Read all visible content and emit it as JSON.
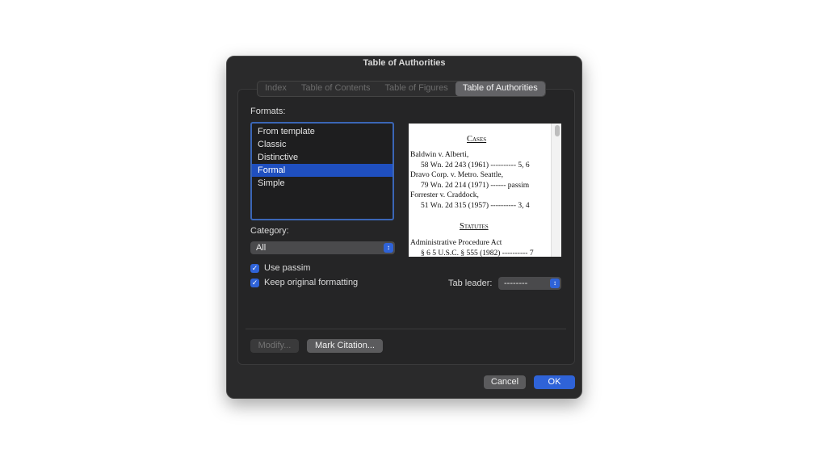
{
  "dialog": {
    "title": "Table of Authorities"
  },
  "tabs": [
    "Index",
    "Table of Contents",
    "Table of Figures",
    "Table of Authorities"
  ],
  "formats": {
    "label": "Formats:",
    "items": [
      "From template",
      "Classic",
      "Distinctive",
      "Formal",
      "Simple"
    ],
    "selected": "Formal"
  },
  "preview": {
    "cases_heading": "Cases",
    "entries": [
      {
        "name": "Baldwin v. Alberti,",
        "cite": "58 Wn. 2d 243 (1961) ---------- 5, 6"
      },
      {
        "name": "Dravo Corp. v. Metro. Seattle,",
        "cite": "79 Wn. 2d 214 (1971) ------ passim"
      },
      {
        "name": "Forrester v. Craddock,",
        "cite": "51 Wn. 2d 315 (1957) ---------- 3, 4"
      }
    ],
    "statutes_heading": "Statutes",
    "statute_name": "Administrative Procedure Act",
    "statute_cite": "§ 6 5 U.S.C. § 555 (1982) ---------- 7"
  },
  "category": {
    "label": "Category:",
    "value": "All"
  },
  "checkboxes": {
    "use_passim": "Use passim",
    "keep_formatting": "Keep original formatting"
  },
  "tab_leader": {
    "label": "Tab leader:",
    "value": "--------"
  },
  "buttons": {
    "modify": "Modify...",
    "mark_citation": "Mark Citation...",
    "cancel": "Cancel",
    "ok": "OK"
  },
  "icons": {
    "checkmark": "checkmark-icon",
    "chevron": "updown-chevron-icon"
  },
  "colors": {
    "accent": "#2f63d8",
    "selection": "#1f4fbf",
    "dialog_bg": "#2a2a2b"
  }
}
